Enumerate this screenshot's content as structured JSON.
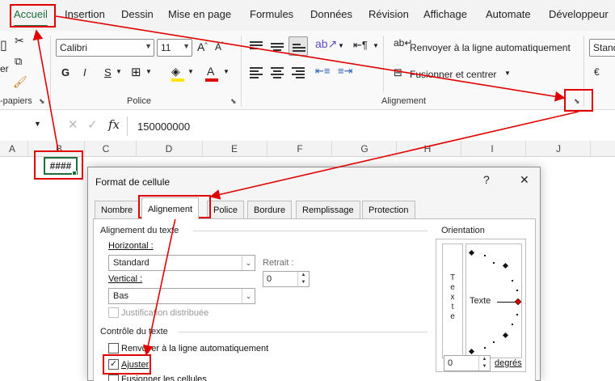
{
  "menu": {
    "tabs": [
      "Accueil",
      "Insertion",
      "Dessin",
      "Mise en page",
      "Formules",
      "Données",
      "Révision",
      "Affichage",
      "Automate",
      "Développeur"
    ],
    "active": "Accueil"
  },
  "ribbon": {
    "clipboard_label": "-papiers",
    "font_label": "Police",
    "alignment_label": "Alignement",
    "font_name": "Calibri",
    "font_size": "11",
    "bold": "G",
    "italic": "I",
    "underline": "S",
    "wrap_text": "Renvoyer à la ligne automatiquement",
    "merge_center": "Fusionner et centrer",
    "number_format": "Stand",
    "paste_partial": "er",
    "accent_color": "#1e6d3c",
    "font_color": "#e00000",
    "highlight_color": "#ffe500"
  },
  "formula": {
    "value": "150000000"
  },
  "columns": [
    "A",
    "B",
    "C",
    "D",
    "E",
    "F",
    "G",
    "H",
    "I",
    "J"
  ],
  "cell": {
    "display": "####"
  },
  "dialog": {
    "title": "Format de cellule",
    "help": "?",
    "close": "✕",
    "tabs": [
      "Nombre",
      "Alignement",
      "Police",
      "Bordure",
      "Remplissage",
      "Protection"
    ],
    "active_tab": "Alignement",
    "text_alignment": {
      "heading": "Alignement du texte",
      "horizontal_label": "Horizontal :",
      "horizontal_value": "Standard",
      "indent_label": "Retrait :",
      "indent_value": "0",
      "vertical_label": "Vertical :",
      "vertical_value": "Bas",
      "justify_distributed": "Justification distribuée"
    },
    "text_control": {
      "heading": "Contrôle du texte",
      "wrap": "Renvoyer à la ligne automatiquement",
      "shrink": "Ajuster",
      "shrink_checked": true,
      "merge": "Fusionner les cellules"
    },
    "orientation": {
      "heading": "Orientation",
      "vertical_text": [
        "T",
        "e",
        "x",
        "t",
        "e"
      ],
      "dial_text": "Texte",
      "degrees_value": "0",
      "degrees_label": "degrés"
    }
  },
  "annotation_color": "#e00000"
}
